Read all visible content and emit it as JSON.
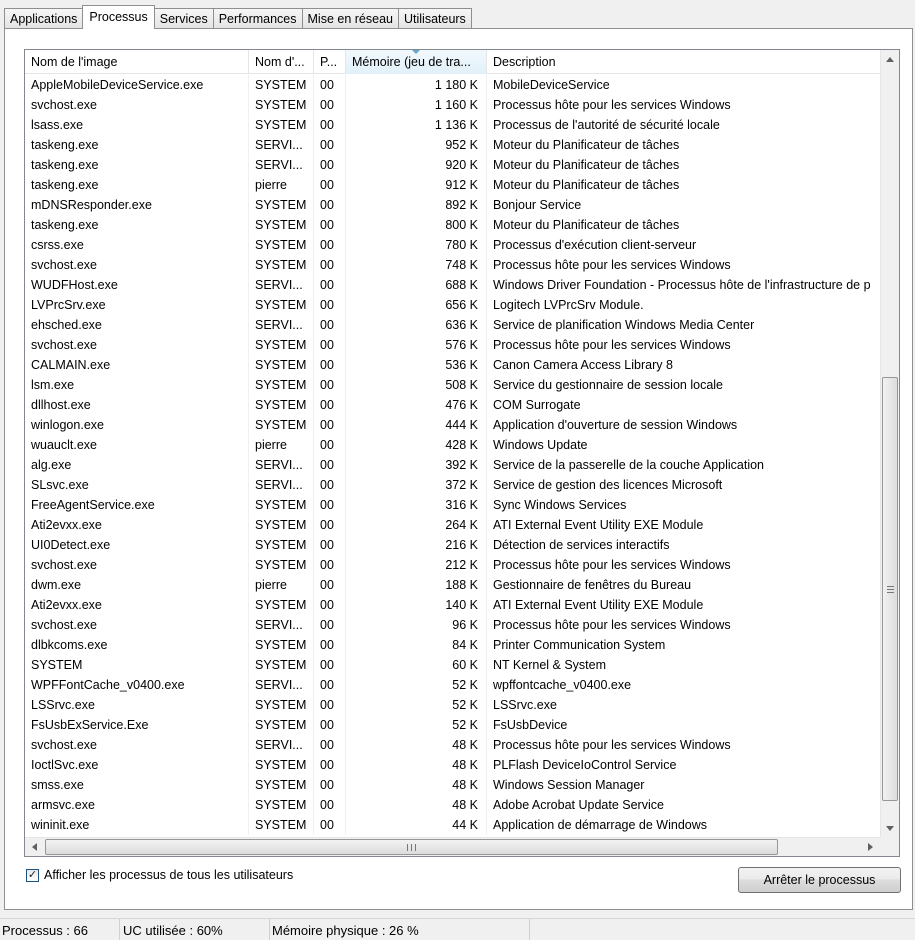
{
  "tabs": [
    "Applications",
    "Processus",
    "Services",
    "Performances",
    "Mise en réseau",
    "Utilisateurs"
  ],
  "active_tab": "Processus",
  "columns": [
    "Nom de l'image",
    "Nom d'...",
    "P...",
    "Mémoire (jeu de tra...",
    "Description"
  ],
  "sorted_column": "Mémoire (jeu de tra...",
  "processes": [
    [
      "AppleMobileDeviceService.exe",
      "SYSTEM",
      "00",
      "1 180 K",
      "MobileDeviceService"
    ],
    [
      "svchost.exe",
      "SYSTEM",
      "00",
      "1 160 K",
      "Processus hôte pour les services Windows"
    ],
    [
      "lsass.exe",
      "SYSTEM",
      "00",
      "1 136 K",
      "Processus de l'autorité de sécurité locale"
    ],
    [
      "taskeng.exe",
      "SERVI...",
      "00",
      "952 K",
      "Moteur du Planificateur de tâches"
    ],
    [
      "taskeng.exe",
      "SERVI...",
      "00",
      "920 K",
      "Moteur du Planificateur de tâches"
    ],
    [
      "taskeng.exe",
      "pierre",
      "00",
      "912 K",
      "Moteur du Planificateur de tâches"
    ],
    [
      "mDNSResponder.exe",
      "SYSTEM",
      "00",
      "892 K",
      "Bonjour Service"
    ],
    [
      "taskeng.exe",
      "SYSTEM",
      "00",
      "800 K",
      "Moteur du Planificateur de tâches"
    ],
    [
      "csrss.exe",
      "SYSTEM",
      "00",
      "780 K",
      "Processus d'exécution client-serveur"
    ],
    [
      "svchost.exe",
      "SYSTEM",
      "00",
      "748 K",
      "Processus hôte pour les services Windows"
    ],
    [
      "WUDFHost.exe",
      "SERVI...",
      "00",
      "688 K",
      "Windows Driver Foundation - Processus hôte de l'infrastructure de p"
    ],
    [
      "LVPrcSrv.exe",
      "SYSTEM",
      "00",
      "656 K",
      "Logitech LVPrcSrv Module."
    ],
    [
      "ehsched.exe",
      "SERVI...",
      "00",
      "636 K",
      "Service de planification Windows Media Center"
    ],
    [
      "svchost.exe",
      "SYSTEM",
      "00",
      "576 K",
      "Processus hôte pour les services Windows"
    ],
    [
      "CALMAIN.exe",
      "SYSTEM",
      "00",
      "536 K",
      "Canon Camera Access Library 8"
    ],
    [
      "lsm.exe",
      "SYSTEM",
      "00",
      "508 K",
      "Service du gestionnaire de session locale"
    ],
    [
      "dllhost.exe",
      "SYSTEM",
      "00",
      "476 K",
      "COM Surrogate"
    ],
    [
      "winlogon.exe",
      "SYSTEM",
      "00",
      "444 K",
      "Application d'ouverture de session Windows"
    ],
    [
      "wuauclt.exe",
      "pierre",
      "00",
      "428 K",
      "Windows Update"
    ],
    [
      "alg.exe",
      "SERVI...",
      "00",
      "392 K",
      "Service de la passerelle de la couche Application"
    ],
    [
      "SLsvc.exe",
      "SERVI...",
      "00",
      "372 K",
      "Service de gestion des licences Microsoft"
    ],
    [
      "FreeAgentService.exe",
      "SYSTEM",
      "00",
      "316 K",
      "Sync Windows Services"
    ],
    [
      "Ati2evxx.exe",
      "SYSTEM",
      "00",
      "264 K",
      "ATI External Event Utility EXE Module"
    ],
    [
      "UI0Detect.exe",
      "SYSTEM",
      "00",
      "216 K",
      "Détection de services interactifs"
    ],
    [
      "svchost.exe",
      "SYSTEM",
      "00",
      "212 K",
      "Processus hôte pour les services Windows"
    ],
    [
      "dwm.exe",
      "pierre",
      "00",
      "188 K",
      "Gestionnaire de fenêtres du Bureau"
    ],
    [
      "Ati2evxx.exe",
      "SYSTEM",
      "00",
      "140 K",
      "ATI External Event Utility EXE Module"
    ],
    [
      "svchost.exe",
      "SERVI...",
      "00",
      "96 K",
      "Processus hôte pour les services Windows"
    ],
    [
      "dlbkcoms.exe",
      "SYSTEM",
      "00",
      "84 K",
      "Printer Communication System"
    ],
    [
      "SYSTEM",
      "SYSTEM",
      "00",
      "60 K",
      "NT Kernel & System"
    ],
    [
      "WPFFontCache_v0400.exe",
      "SERVI...",
      "00",
      "52 K",
      "wpffontcache_v0400.exe"
    ],
    [
      "LSSrvc.exe",
      "SYSTEM",
      "00",
      "52 K",
      "LSSrvc.exe"
    ],
    [
      "FsUsbExService.Exe",
      "SYSTEM",
      "00",
      "52 K",
      "FsUsbDevice"
    ],
    [
      "svchost.exe",
      "SERVI...",
      "00",
      "48 K",
      "Processus hôte pour les services Windows"
    ],
    [
      "IoctlSvc.exe",
      "SYSTEM",
      "00",
      "48 K",
      "PLFlash DeviceIoControl Service"
    ],
    [
      "smss.exe",
      "SYSTEM",
      "00",
      "48 K",
      "Windows Session Manager"
    ],
    [
      "armsvc.exe",
      "SYSTEM",
      "00",
      "48 K",
      "Adobe Acrobat Update Service"
    ],
    [
      "wininit.exe",
      "SYSTEM",
      "00",
      "44 K",
      "Application de démarrage de Windows"
    ]
  ],
  "show_all_users": {
    "label": "Afficher les processus de tous les utilisateurs",
    "checked": true
  },
  "end_process_button": "Arrêter le processus",
  "status": {
    "processes": "Processus : 66",
    "cpu": "UC utilisée : 60%",
    "memory": "Mémoire physique : 26 %"
  },
  "colors": {
    "sorted_header": "#e1f0f9",
    "window_bg": "#f0f0f0"
  }
}
